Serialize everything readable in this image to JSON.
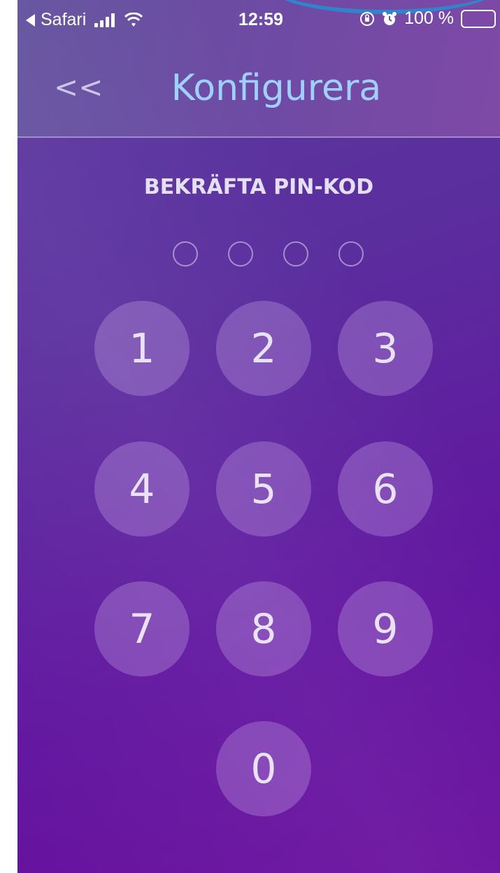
{
  "status_bar": {
    "back_app": "Safari",
    "time": "12:59",
    "battery": "100 %",
    "battery_level": 1.0
  },
  "nav": {
    "back_symbol": "<<",
    "title": "Konfigurera"
  },
  "pin": {
    "heading": "BEKRÄFTA PIN-KOD",
    "length": 4,
    "entered": 0
  },
  "keypad": [
    "1",
    "2",
    "3",
    "4",
    "5",
    "6",
    "7",
    "8",
    "9",
    "0"
  ],
  "colors": {
    "background": "#5e2a9f",
    "title": "#9fd0ff",
    "key_fill": "rgba(205,175,235,0.30)"
  },
  "icons": [
    "back-arrow-icon",
    "signal-icon",
    "wifi-icon",
    "orientation-lock-icon",
    "alarm-icon",
    "battery-icon"
  ]
}
